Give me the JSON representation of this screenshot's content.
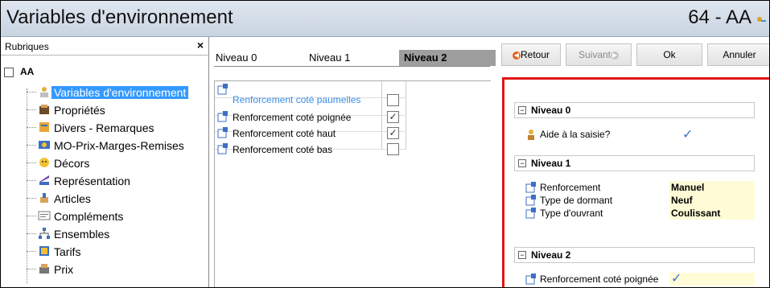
{
  "window": {
    "title": "Variables d'environnement",
    "code": "64 - AA"
  },
  "left": {
    "header": "Rubriques",
    "close": "×",
    "root": "AA",
    "items": [
      {
        "label": "Variables d'environnement",
        "icon": "environment-icon",
        "selected": true
      },
      {
        "label": "Propriétés",
        "icon": "properties-icon"
      },
      {
        "label": "Divers - Remarques",
        "icon": "notes-icon"
      },
      {
        "label": "MO-Prix-Marges-Remises",
        "icon": "price-icon"
      },
      {
        "label": "Décors",
        "icon": "decor-icon"
      },
      {
        "label": "Représentation",
        "icon": "representation-icon"
      },
      {
        "label": "Articles",
        "icon": "articles-icon"
      },
      {
        "label": "Compléments",
        "icon": "complements-icon"
      },
      {
        "label": "Ensembles",
        "icon": "ensembles-icon"
      },
      {
        "label": "Tarifs",
        "icon": "tarifs-icon"
      },
      {
        "label": "Prix",
        "icon": "prix-icon"
      }
    ]
  },
  "middle": {
    "tabs": [
      "Niveau 0",
      "Niveau 1",
      "Niveau 2"
    ],
    "active_tab": "Niveau 2",
    "rows": [
      {
        "label": "Renforcement coté paumelles",
        "checked": false,
        "highlight": true
      },
      {
        "label": "Renforcement coté poignée",
        "checked": true
      },
      {
        "label": "Renforcement coté haut",
        "checked": true
      },
      {
        "label": "Renforcement coté bas",
        "checked": false
      }
    ]
  },
  "toolbar": {
    "retour": "Retour",
    "suivant": "Suivant",
    "ok": "Ok",
    "annuler": "Annuler"
  },
  "right": {
    "sections": [
      {
        "title": "Niveau 0",
        "props": [
          {
            "label": "Aide à la saisie?",
            "value": "✓",
            "type": "check"
          }
        ]
      },
      {
        "title": "Niveau 1",
        "props": [
          {
            "label": "Renforcement",
            "value": "Manuel"
          },
          {
            "label": "Type de dormant",
            "value": "Neuf"
          },
          {
            "label": "Type d'ouvrant",
            "value": "Coulissant"
          }
        ]
      },
      {
        "title": "Niveau 2",
        "props": [
          {
            "label": "Renforcement coté poignée",
            "value": "✓",
            "type": "check"
          }
        ]
      }
    ]
  },
  "colors": {
    "selection": "#3399ff",
    "highlight_border": "#e21515",
    "value_bg": "#fffbd6",
    "tab_active": "#9e9e9e"
  }
}
